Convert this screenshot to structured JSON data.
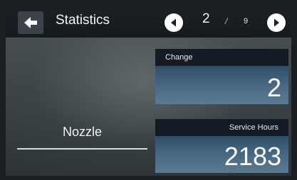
{
  "header": {
    "title": "Statistics",
    "page_current": "2",
    "page_separator": "/",
    "page_total": "9"
  },
  "item": {
    "label": "Nozzle"
  },
  "cards": {
    "change": {
      "label": "Change",
      "value": "2"
    },
    "service_hours": {
      "label": "Service Hours",
      "value": "2183"
    }
  },
  "icons": {
    "back": "arrow-left-icon",
    "prev": "triangle-left-icon",
    "next": "triangle-right-icon"
  },
  "colors": {
    "header_bg": "#181d22",
    "card_header_bg": "#141b24",
    "card_body_top": "#2f4d66",
    "card_body_bottom": "#5b7a92"
  }
}
